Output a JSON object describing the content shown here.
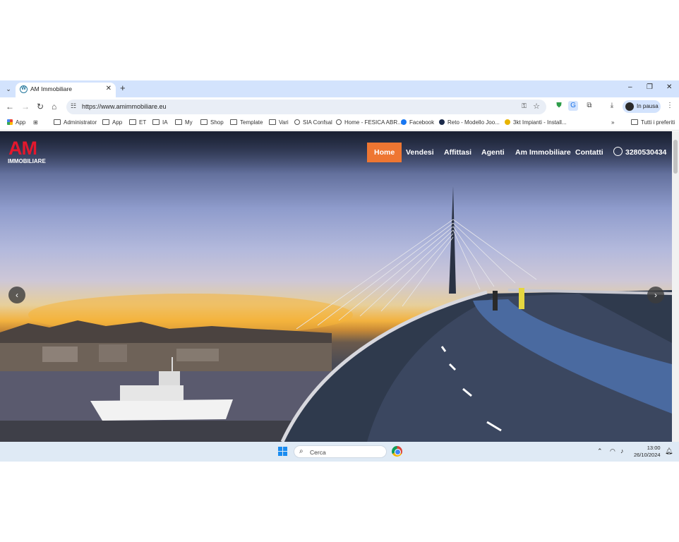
{
  "browser": {
    "tab_title": "AM Immobiliare",
    "url": "https://www.amimmobiliare.eu",
    "profile_label": "In pausa",
    "new_tab": "+",
    "close_tab": "✕",
    "win_min": "–",
    "win_max": "❐",
    "win_close": "✕"
  },
  "bookmarks": {
    "items": [
      {
        "label": "App",
        "kind": "apps"
      },
      {
        "label": "Administrator",
        "kind": "folder"
      },
      {
        "label": "App",
        "kind": "folder"
      },
      {
        "label": "ET",
        "kind": "folder"
      },
      {
        "label": "IA",
        "kind": "folder"
      },
      {
        "label": "My",
        "kind": "folder"
      },
      {
        "label": "Shop",
        "kind": "folder"
      },
      {
        "label": "Template",
        "kind": "folder"
      },
      {
        "label": "Vari",
        "kind": "folder"
      },
      {
        "label": "SIA Confsal",
        "kind": "site"
      },
      {
        "label": "Home - FESICA ABR...",
        "kind": "site"
      },
      {
        "label": "Facebook",
        "kind": "site"
      },
      {
        "label": "Reto - Modello Joo...",
        "kind": "site"
      },
      {
        "label": "3kt Impianti - Install...",
        "kind": "site"
      }
    ],
    "overflow": "»",
    "all_label": "Tutti i preferiti"
  },
  "site": {
    "logo_main": "AM",
    "logo_sub": "IMMOBILIARE",
    "nav": [
      "Home",
      "Vendesi",
      "Affittasi",
      "Agenti",
      "Am Immobiliare",
      "Contatti"
    ],
    "active_nav": "Home",
    "phone": "3280530434",
    "accent_color": "#ee7632",
    "logo_color": "#e3182d"
  },
  "taskbar": {
    "search_label": "Cerca",
    "time": "13:00",
    "date": "26/10/2024"
  }
}
